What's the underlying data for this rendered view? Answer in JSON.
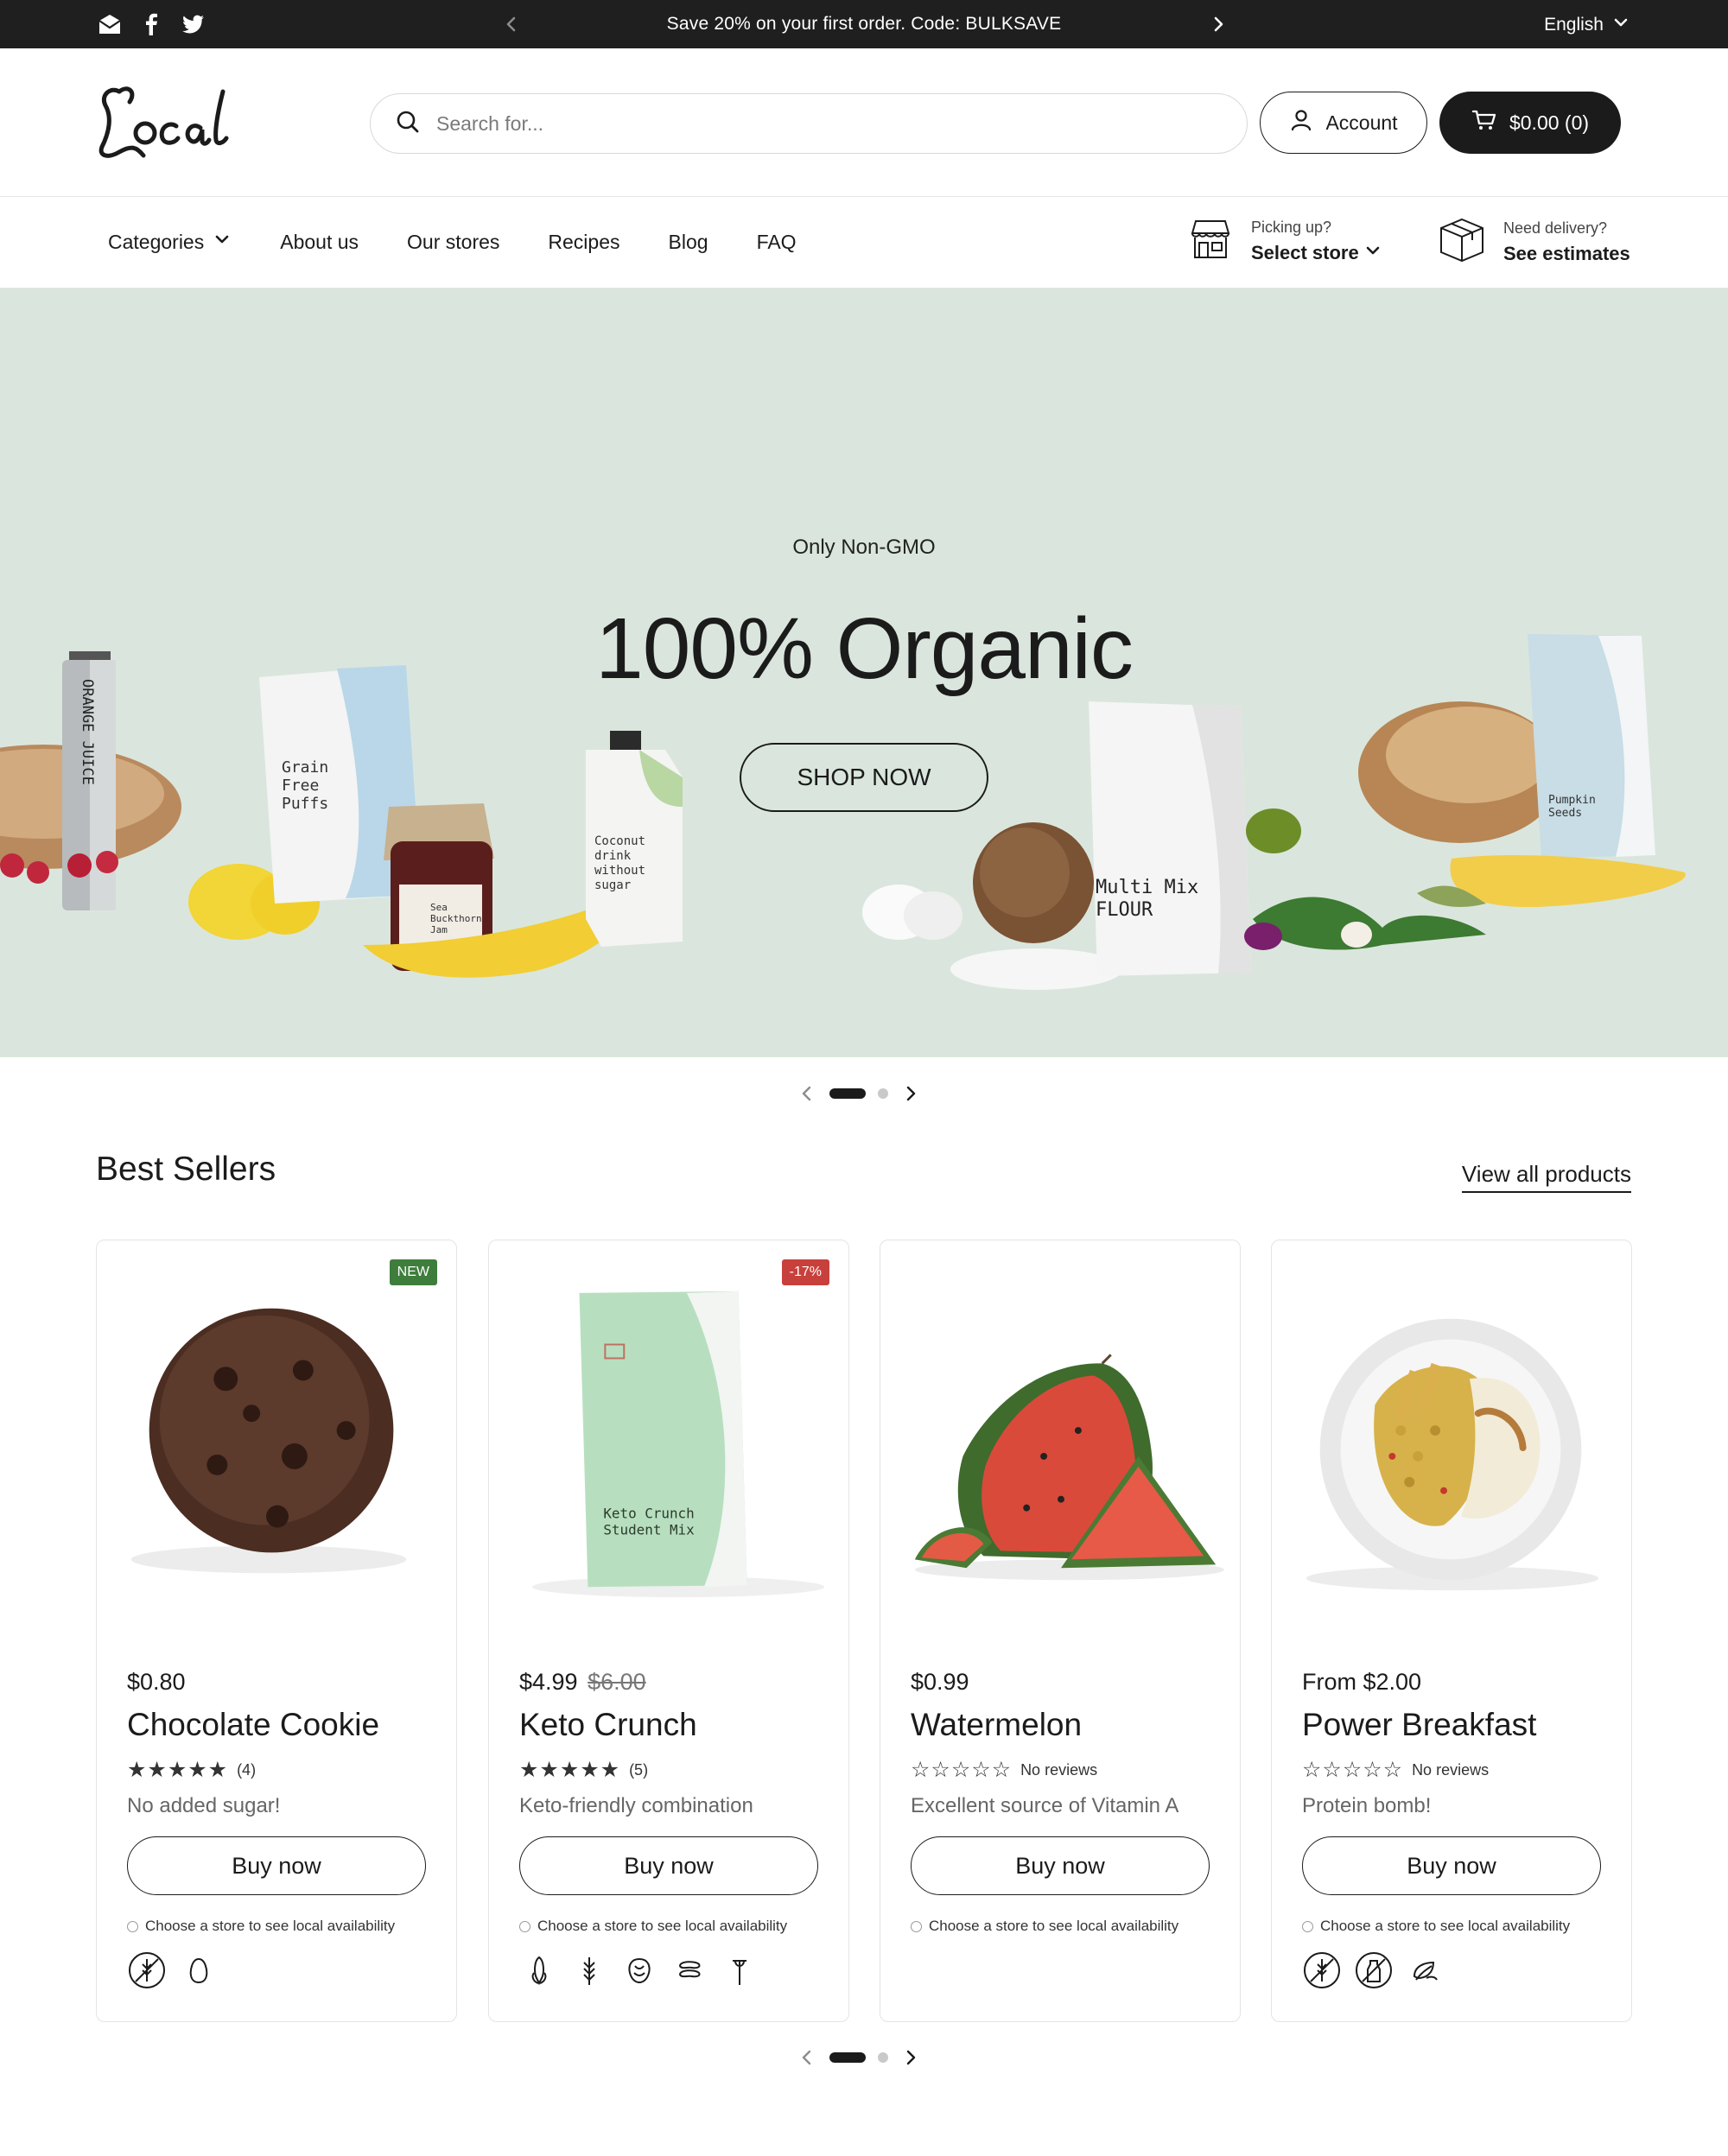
{
  "announcement": {
    "text": "Save 20% on your first order. Code: BULKSAVE",
    "language": "English",
    "social_icons": [
      "email-icon",
      "facebook-icon",
      "twitter-icon"
    ]
  },
  "header": {
    "logo_text": "Local",
    "search_placeholder": "Search for...",
    "account_label": "Account",
    "cart_label": "$0.00 (0)"
  },
  "nav": {
    "links": [
      "Categories",
      "About us",
      "Our stores",
      "Recipes",
      "Blog",
      "FAQ"
    ],
    "pickup": {
      "small": "Picking up?",
      "big": "Select store"
    },
    "delivery": {
      "small": "Need delivery?",
      "big": "See estimates"
    }
  },
  "hero": {
    "kicker": "Only Non-GMO",
    "headline": "100% Organic",
    "cta": "SHOP NOW",
    "background": "#dae6dd",
    "slide_labels": {
      "juice": "ORANGE JUICE",
      "puffs": [
        "Grain",
        "Free",
        "Puffs"
      ],
      "jam": [
        "Sea",
        "Buckthorn",
        "Jam"
      ],
      "coconut": [
        "Coconut",
        "drink",
        "without",
        "sugar"
      ],
      "flour": [
        "Multi Mix",
        "FLOUR"
      ],
      "seeds": [
        "Pumpkin",
        "Seeds"
      ]
    }
  },
  "best_sellers": {
    "title": "Best Sellers",
    "view_all": "View all products",
    "products": [
      {
        "name": "Chocolate Cookie",
        "price": "$0.80",
        "old_price": "",
        "badge": "NEW",
        "badge_color": "#3f7d3c",
        "rating": 5,
        "review_text": "(4)",
        "description": "No added sugar!",
        "buy_label": "Buy now",
        "availability": "Choose a store to see local availability",
        "diet_icons": [
          "gluten-free-icon",
          "egg-free-icon"
        ]
      },
      {
        "name": "Keto Crunch",
        "price": "$4.99",
        "old_price": "$6.00",
        "badge": "-17%",
        "badge_color": "#c8403c",
        "package_label": [
          "Keto Crunch",
          "Student Mix"
        ],
        "rating": 5,
        "review_text": "(5)",
        "description": "Keto-friendly combination",
        "buy_label": "Buy now",
        "availability": "Choose a store to see local availability",
        "diet_icons": [
          "corn-icon",
          "wheat-icon",
          "nut-icon",
          "bean-icon",
          "grain-icon"
        ]
      },
      {
        "name": "Watermelon",
        "price": "$0.99",
        "old_price": "",
        "badge": "",
        "rating": 0,
        "review_text": "No reviews",
        "description": "Excellent source of Vitamin A",
        "buy_label": "Buy now",
        "availability": "Choose a store to see local availability",
        "diet_icons": []
      },
      {
        "name": "Power Breakfast",
        "price": "From $2.00",
        "old_price": "",
        "badge": "",
        "rating": 0,
        "review_text": "No reviews",
        "description": "Protein bomb!",
        "buy_label": "Buy now",
        "availability": "Choose a store to see local availability",
        "diet_icons": [
          "gluten-free-icon",
          "dairy-free-icon",
          "vegan-icon"
        ]
      }
    ]
  }
}
